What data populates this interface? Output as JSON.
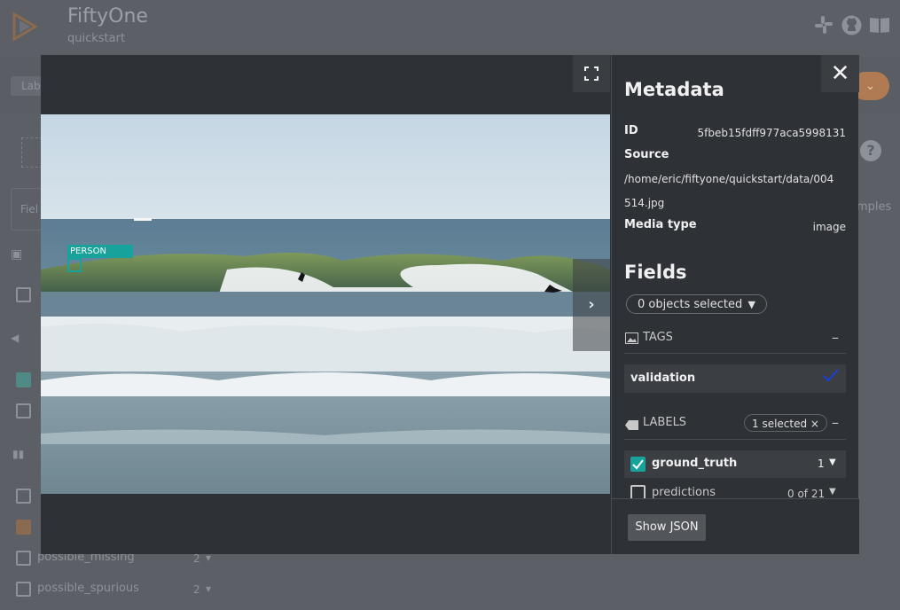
{
  "app": {
    "name": "FiftyOne",
    "dataset": "quickstart"
  },
  "background": {
    "tab_label": "Lab",
    "samples_label": "mples",
    "help_symbol": "?",
    "search_label": "Fiel",
    "sidebar_rows": [
      {
        "label": "possible_missing",
        "count": "2"
      },
      {
        "label": "possible_spurious",
        "count": "2"
      }
    ]
  },
  "modal": {
    "detection_label": "PERSON",
    "next_symbol": "›",
    "close_symbol": "✕",
    "metadata": {
      "title": "Metadata",
      "id_key": "ID",
      "id_value": "5fbeb15fdff977aca5998131",
      "source_key": "Source",
      "source_value_line1": "/home/eric/fiftyone/quickstart/data/004",
      "source_value_line2": "514.jpg",
      "media_key": "Media type",
      "media_value": "image"
    },
    "fields": {
      "title": "Fields",
      "objects_select": "0 objects selected"
    },
    "tags": {
      "title": "TAGS",
      "items": [
        {
          "label": "validation"
        }
      ]
    },
    "labels": {
      "title": "LABELS",
      "selected_chip": "1 selected  ×",
      "items": [
        {
          "label": "ground_truth",
          "count": "1",
          "checked": true
        },
        {
          "label": "predictions",
          "count": "0 of 21",
          "checked": false
        }
      ]
    },
    "show_json_label": "Show JSON"
  },
  "colors": {
    "accent_teal": "#17a39b",
    "checkbox_teal": "#17a39b",
    "validation_check": "#1d3fd9",
    "brand_orange": "#b07a52"
  }
}
